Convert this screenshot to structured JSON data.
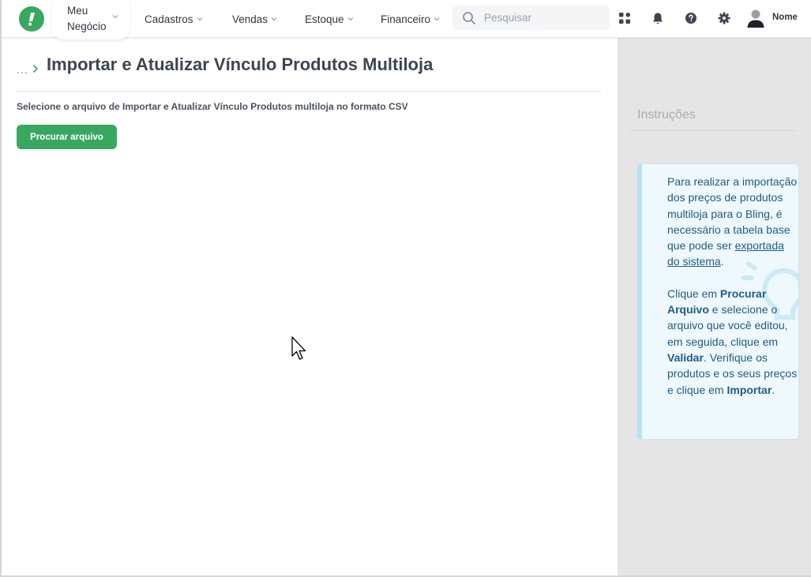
{
  "topbar": {
    "meu_negocio_line1": "Meu",
    "meu_negocio_line2": "Negócio",
    "nav": [
      "Cadastros",
      "Vendas",
      "Estoque",
      "Financeiro"
    ],
    "search_placeholder": "Pesquisar",
    "user_name": "Nome"
  },
  "page": {
    "breadcrumb": "...",
    "title": "Importar e Atualizar Vínculo Produtos Multiloja",
    "instruction": "Selecione o arquivo de Importar e Atualizar Vínculo Produtos multiloja no formato CSV",
    "browse_button": "Procurar arquivo"
  },
  "sidebar": {
    "title": "Instruções",
    "p1_text": "Para realizar a importação dos preços de produtos multiloja para o Bling, é necessário a tabela base que pode ser ",
    "p1_link": "exportada do sistema",
    "p1_end": ".",
    "p2_a": "Clique em ",
    "p2_b": "Procurar Arquivo",
    "p2_c": " e selecione o arquivo que você editou, em seguida, clique em ",
    "p2_d": "Validar",
    "p2_e": ". Verifique os produtos e os seus preços e clique em ",
    "p2_f": "Importar",
    "p2_g": "."
  },
  "colors": {
    "brand_green": "#38a861",
    "info_text": "#1f5c86",
    "info_bg": "#eef8fd",
    "sidebar_bg": "#e5e5e5"
  },
  "icons": [
    "logo-icon",
    "chevron-down-icon",
    "search-icon",
    "apps-grid-icon",
    "bell-icon",
    "help-icon",
    "gear-icon",
    "user-avatar-icon",
    "chevron-right-icon",
    "lightbulb-icon",
    "mouse-cursor-icon"
  ]
}
